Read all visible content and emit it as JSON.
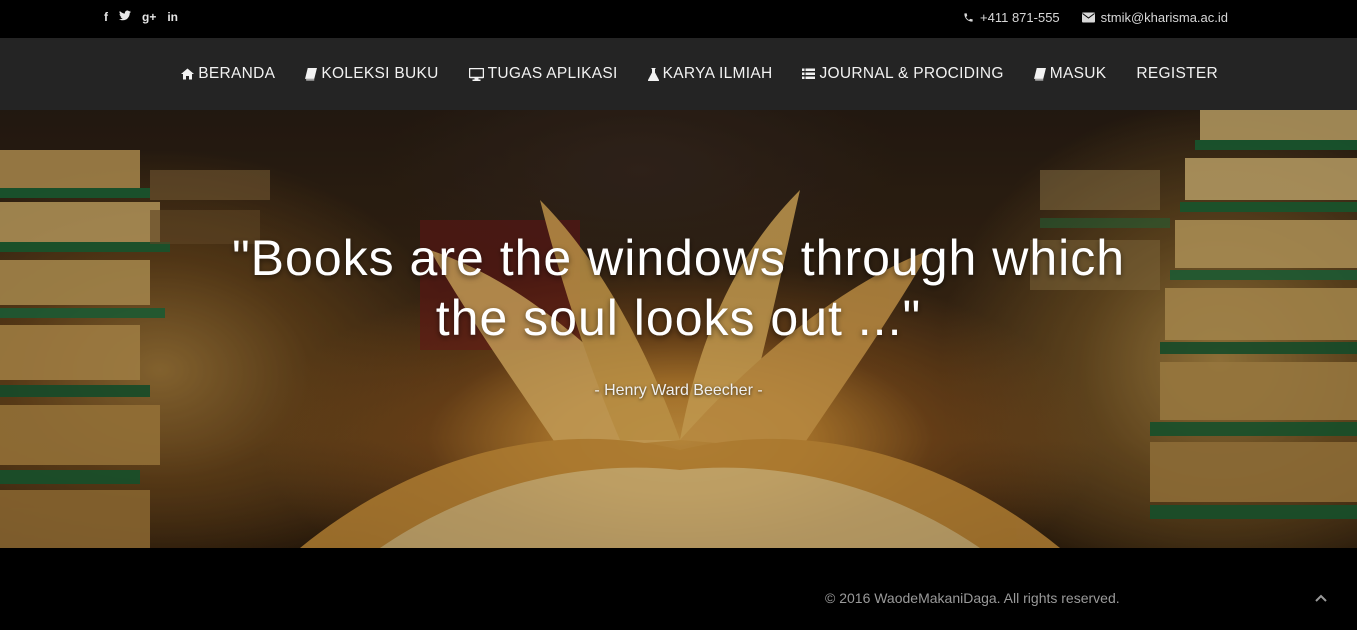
{
  "topbar": {
    "socials": [
      {
        "icon": "facebook-icon",
        "glyph": "f"
      },
      {
        "icon": "twitter-icon",
        "glyph": "t"
      },
      {
        "icon": "google-plus-icon",
        "glyph": "g+"
      },
      {
        "icon": "linkedin-icon",
        "glyph": "in"
      }
    ],
    "phone": "+411 871-555",
    "email": "stmik@kharisma.ac.id"
  },
  "nav": {
    "items": [
      {
        "label": "BERANDA",
        "icon": "home-icon"
      },
      {
        "label": "KOLEKSI BUKU",
        "icon": "book-icon"
      },
      {
        "label": "TUGAS APLIKASI",
        "icon": "desktop-icon"
      },
      {
        "label": "KARYA ILMIAH",
        "icon": "flask-icon"
      },
      {
        "label": "JOURNAL & PROCIDING",
        "icon": "list-icon"
      },
      {
        "label": "MASUK",
        "icon": "book-icon"
      },
      {
        "label": "REGISTER",
        "icon": ""
      }
    ]
  },
  "hero": {
    "quote_line1": "\"Books are the windows through which",
    "quote_line2": "the soul looks out ...\"",
    "author": "- Henry Ward Beecher -"
  },
  "footer": {
    "copyright": "© 2016 WaodeMakaniDaga. All rights reserved.",
    "to_top_icon": "chevron-up-icon"
  },
  "colors": {
    "topbar_bg": "#000000",
    "navbar_bg": "#242424",
    "footer_bg": "#000000",
    "footer_text": "#9a9a9a"
  }
}
